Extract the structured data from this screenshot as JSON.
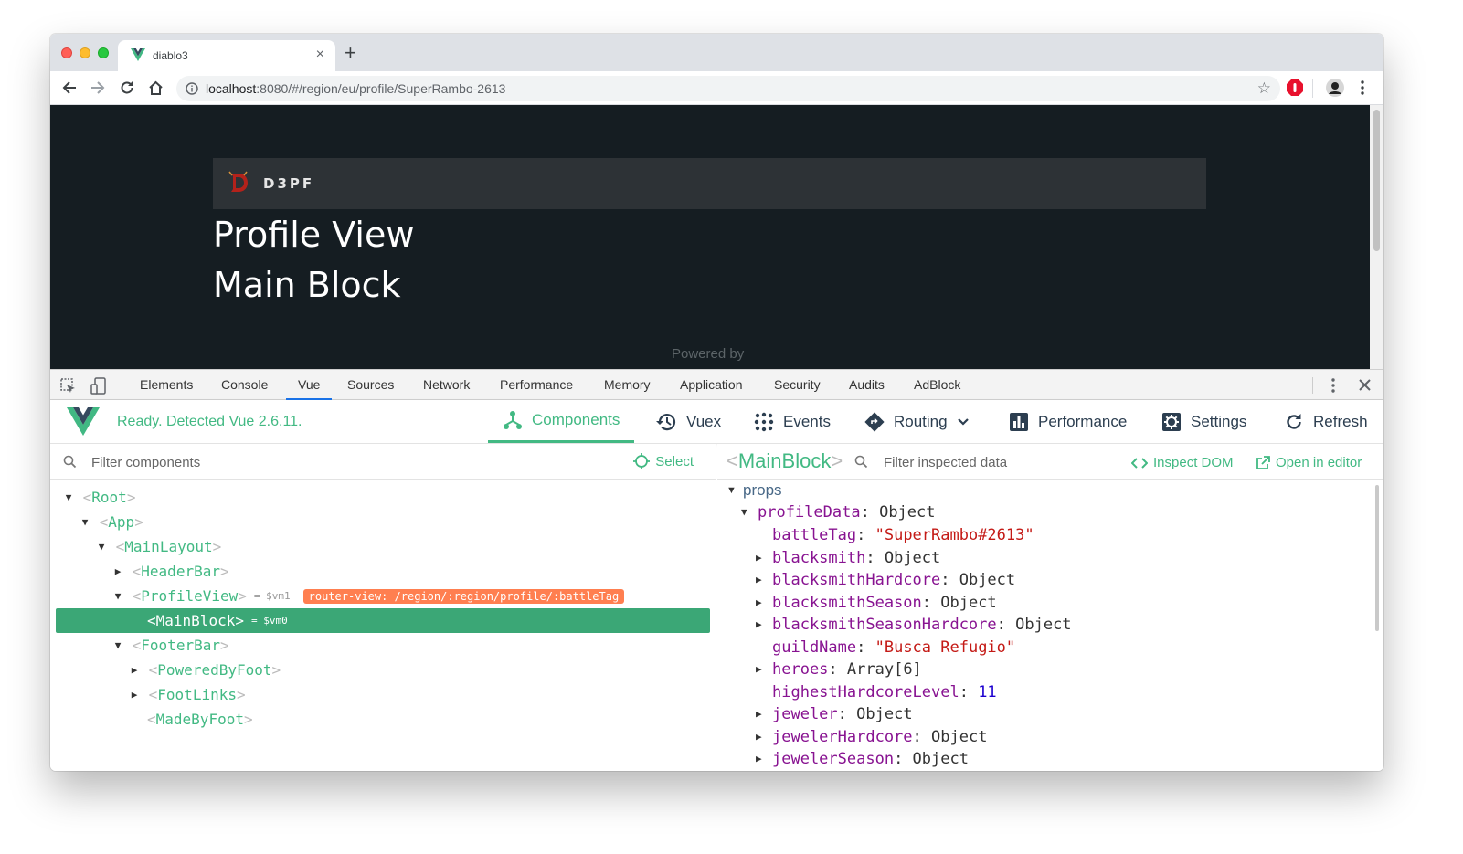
{
  "browser": {
    "tab_title": "diablo3",
    "new_tab": "+",
    "tab_close": "×",
    "url_host": "localhost",
    "url_rest": ":8080/#/region/eu/profile/SuperRambo-2613"
  },
  "page": {
    "brand": "D3PF",
    "heading1": "Profile View",
    "heading2": "Main Block",
    "footer_text": "Powered by"
  },
  "devtools": {
    "tabs": [
      "Elements",
      "Console",
      "Vue",
      "Sources",
      "Network",
      "Performance",
      "Memory",
      "Application",
      "Security",
      "Audits",
      "AdBlock"
    ],
    "active_tab": "Vue"
  },
  "vue": {
    "status": "Ready. Detected Vue 2.6.11.",
    "nav": {
      "components": "Components",
      "vuex": "Vuex",
      "events": "Events",
      "routing": "Routing",
      "performance": "Performance",
      "settings": "Settings",
      "refresh": "Refresh"
    },
    "filter_placeholder": "Filter components",
    "select_label": "Select",
    "tree": [
      {
        "name": "Root",
        "open": true
      },
      {
        "name": "App",
        "open": true
      },
      {
        "name": "MainLayout",
        "open": true
      },
      {
        "name": "HeaderBar",
        "open": false
      },
      {
        "name": "ProfileView",
        "open": true,
        "vm": "= $vm1",
        "badge": "router-view: /region/:region/profile/:battleTag"
      },
      {
        "name": "MainBlock",
        "vm": "= $vm0",
        "selected": true
      },
      {
        "name": "FooterBar",
        "open": true
      },
      {
        "name": "PoweredByFoot",
        "open": false
      },
      {
        "name": "FootLinks",
        "open": false
      },
      {
        "name": "MadeByFoot"
      }
    ],
    "inspector": {
      "component": "MainBlock",
      "filter_placeholder": "Filter inspected data",
      "inspect_dom": "Inspect DOM",
      "open_editor": "Open in editor",
      "section": "props",
      "root_key": "profileData",
      "root_value": "Object",
      "fields": [
        {
          "key": "battleTag",
          "value": "\"SuperRambo#2613\"",
          "kind": "string",
          "expandable": false
        },
        {
          "key": "blacksmith",
          "value": "Object",
          "kind": "object",
          "expandable": true
        },
        {
          "key": "blacksmithHardcore",
          "value": "Object",
          "kind": "object",
          "expandable": true
        },
        {
          "key": "blacksmithSeason",
          "value": "Object",
          "kind": "object",
          "expandable": true
        },
        {
          "key": "blacksmithSeasonHardcore",
          "value": "Object",
          "kind": "object",
          "expandable": true
        },
        {
          "key": "guildName",
          "value": "\"Busca Refugio\"",
          "kind": "string",
          "expandable": false
        },
        {
          "key": "heroes",
          "value": "Array[6]",
          "kind": "object",
          "expandable": true
        },
        {
          "key": "highestHardcoreLevel",
          "value": "11",
          "kind": "number",
          "expandable": false
        },
        {
          "key": "jeweler",
          "value": "Object",
          "kind": "object",
          "expandable": true
        },
        {
          "key": "jewelerHardcore",
          "value": "Object",
          "kind": "object",
          "expandable": true
        },
        {
          "key": "jewelerSeason",
          "value": "Object",
          "kind": "object",
          "expandable": true
        }
      ]
    }
  },
  "colors": {
    "vue_green": "#42b983",
    "page_bg": "#151d22",
    "selected_row": "#3ba776",
    "badge": "#ff7f50"
  }
}
